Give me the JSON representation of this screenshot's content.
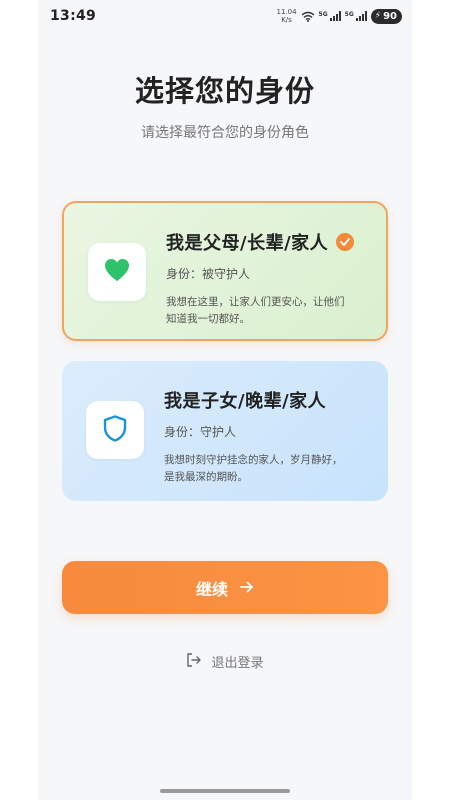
{
  "status_bar": {
    "time": "13:49",
    "net_speed_value": "11.04",
    "net_speed_unit": "K/s",
    "sim1_label": "5G",
    "sim2_label": "5G",
    "battery_level": "90"
  },
  "page": {
    "title": "选择您的身份",
    "subtitle": "请选择最符合您的身份角色"
  },
  "cards": [
    {
      "title": "我是父母/长辈/家人",
      "role": "身份：被守护人",
      "description_line1": "我想在这里，让家人们更安心，让他们",
      "description_line2": "知道我一切都好。",
      "icon": "heart-icon",
      "selected": true,
      "icon_color": "#2dc26b"
    },
    {
      "title": "我是子女/晚辈/家人",
      "role": "身份：守护人",
      "description_line1": "我想时刻守护挂念的家人，岁月静好，",
      "description_line2": "是我最深的期盼。",
      "icon": "shield-icon",
      "selected": false,
      "icon_color": "#1a95d4"
    }
  ],
  "actions": {
    "continue_label": "继续",
    "logout_label": "退出登录"
  },
  "colors": {
    "accent": "#f78a3d",
    "selected_border": "#f0a460"
  }
}
